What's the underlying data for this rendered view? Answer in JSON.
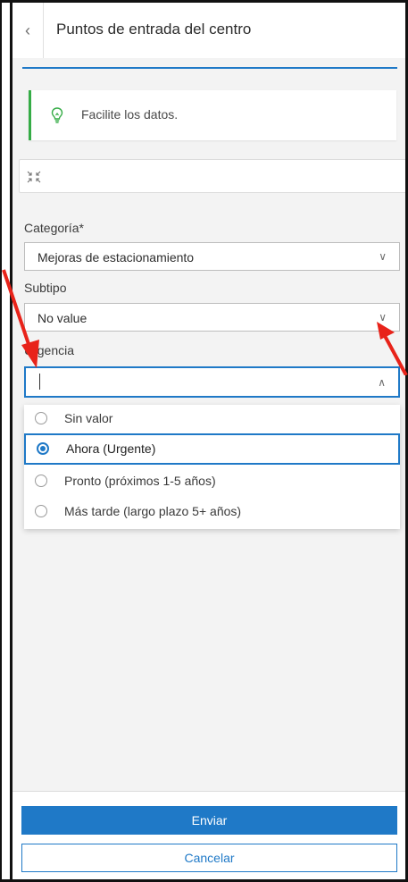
{
  "header": {
    "back_icon": "chevron-left-icon",
    "title": "Puntos de entrada del centro"
  },
  "notice": {
    "icon": "lightbulb-icon",
    "text": "Facilite los datos."
  },
  "collapse": {
    "icon": "collapse-arrows-icon"
  },
  "fields": {
    "categoria": {
      "label": "Categoría*",
      "value": "Mejoras de estacionamiento"
    },
    "subtipo": {
      "label": "Subtipo",
      "value": "No value"
    },
    "urgencia": {
      "label": "Urgencia",
      "value": ""
    }
  },
  "dropdown": {
    "options": [
      {
        "label": "Sin valor",
        "selected": false
      },
      {
        "label": "Ahora (Urgente)",
        "selected": true
      },
      {
        "label": "Pronto (próximos 1-5 años)",
        "selected": false
      },
      {
        "label": "Más tarde (largo plazo 5+ años)",
        "selected": false
      }
    ]
  },
  "footer": {
    "submit_label": "Enviar",
    "cancel_label": "Cancelar"
  },
  "colors": {
    "accent": "#1f79c7",
    "notice_accent": "#35ac46",
    "annotation": "#e8231a"
  }
}
